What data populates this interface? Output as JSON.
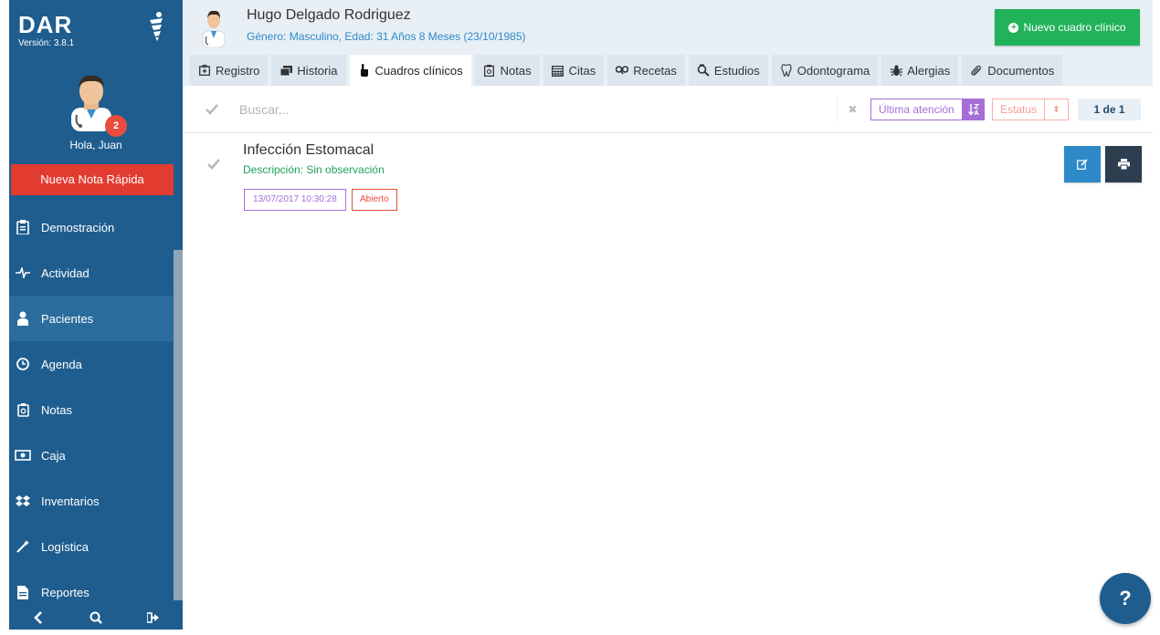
{
  "sidebar": {
    "brand": "DAR",
    "version": "Versión: 3.8.1",
    "badge_count": "2",
    "greeting": "Hola, Juan",
    "quick_note_label": "Nueva Nota Rápida",
    "items": [
      {
        "label": "Demostración",
        "icon": "clipboard-icon"
      },
      {
        "label": "Actividad",
        "icon": "pulse-icon"
      },
      {
        "label": "Pacientes",
        "icon": "patient-icon"
      },
      {
        "label": "Agenda",
        "icon": "clock-icon"
      },
      {
        "label": "Notas",
        "icon": "notes-icon"
      },
      {
        "label": "Caja",
        "icon": "money-icon"
      },
      {
        "label": "Inventarios",
        "icon": "dropbox-icon"
      },
      {
        "label": "Logística",
        "icon": "magic-wand-icon"
      },
      {
        "label": "Reportes",
        "icon": "file-icon"
      }
    ]
  },
  "header": {
    "patient_name": "Hugo Delgado Rodriguez",
    "patient_info": "Género: Masculino, Edad: 31 Años 8 Meses (23/10/1985)",
    "new_button_label": "Nuevo cuadro clínico"
  },
  "tabs": [
    {
      "label": "Registro",
      "icon": "medkit-icon"
    },
    {
      "label": "Historia",
      "icon": "history-icon"
    },
    {
      "label": "Cuadros clínicos",
      "icon": "hand-pointer-icon"
    },
    {
      "label": "Notas",
      "icon": "clipboard-icon"
    },
    {
      "label": "Citas",
      "icon": "calendar-icon"
    },
    {
      "label": "Recetas",
      "icon": "pills-icon"
    },
    {
      "label": "Estudios",
      "icon": "search-file-icon"
    },
    {
      "label": "Odontograma",
      "icon": "tooth-icon"
    },
    {
      "label": "Alergias",
      "icon": "bug-icon"
    },
    {
      "label": "Documentos",
      "icon": "paperclip-icon"
    }
  ],
  "search": {
    "placeholder": "Buscar...",
    "sort_label": "Última atención",
    "status_label": "Estatus",
    "pager": "1 de 1"
  },
  "record": {
    "title": "Infección Estomacal",
    "description": "Descripción: Sin observación",
    "date": "13/07/2017 10:30:28",
    "status": "Abierto"
  },
  "help_label": "?",
  "colors": {
    "sidebar": "#1f5d8e",
    "accent_green": "#22b25a",
    "accent_purple": "#a56fd6",
    "accent_red": "#e74c3c",
    "link_blue": "#2d89c8"
  }
}
